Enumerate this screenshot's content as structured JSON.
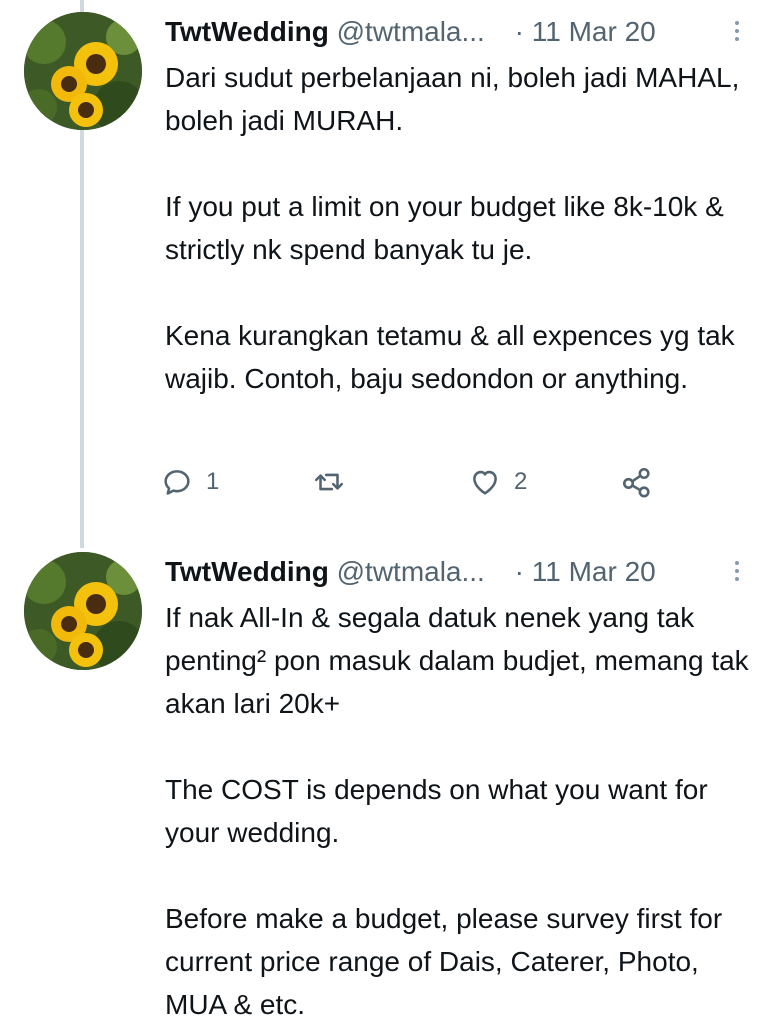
{
  "tweets": [
    {
      "author_name": "TwtWedding",
      "handle": "@twtmala...",
      "separator": "·",
      "date": "11 Mar 20",
      "paragraphs": [
        "Dari sudut perbelanjaan ni, boleh jadi MAHAL, boleh jadi MURAH.",
        "If you put a limit on your budget like 8k-10k & strictly nk spend banyak tu je.",
        "Kena kurangkan tetamu & all expences yg tak wajib. Contoh, baju sedondon or anything."
      ],
      "reply_count": "1",
      "retweet_count": "",
      "like_count": "2"
    },
    {
      "author_name": "TwtWedding",
      "handle": "@twtmala...",
      "separator": "·",
      "date": "11 Mar 20",
      "paragraphs": [
        "If nak All-In & segala datuk nenek yang tak penting² pon masuk dalam budjet, memang tak akan lari 20k+",
        "The COST is depends on what you want for your wedding.",
        "Before make a budget, please survey first for current price range of Dais, Caterer, Photo, MUA & etc."
      ]
    }
  ],
  "icons": {
    "reply": "reply-icon",
    "retweet": "retweet-icon",
    "like": "heart-icon",
    "share": "share-icon",
    "more": "more-options-icon"
  },
  "colors": {
    "text": "#0f1419",
    "secondary": "#536471",
    "thread_line": "#cfd9de"
  }
}
